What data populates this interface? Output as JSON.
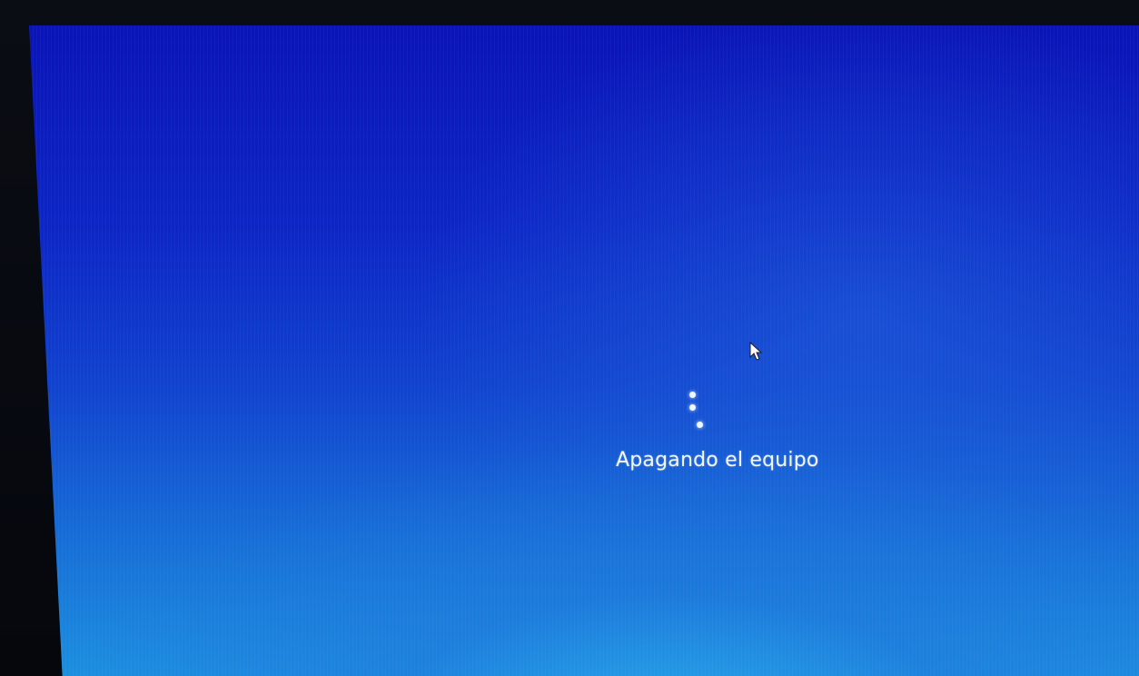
{
  "shutdown_screen": {
    "status_text": "Apagando el equipo",
    "spinner_icon": "loading-dots-icon",
    "cursor_icon": "mouse-pointer-icon"
  },
  "colors": {
    "background_top": "#0a14b8",
    "background_bottom": "#1b8fe0",
    "text": "#f2f7ff"
  }
}
